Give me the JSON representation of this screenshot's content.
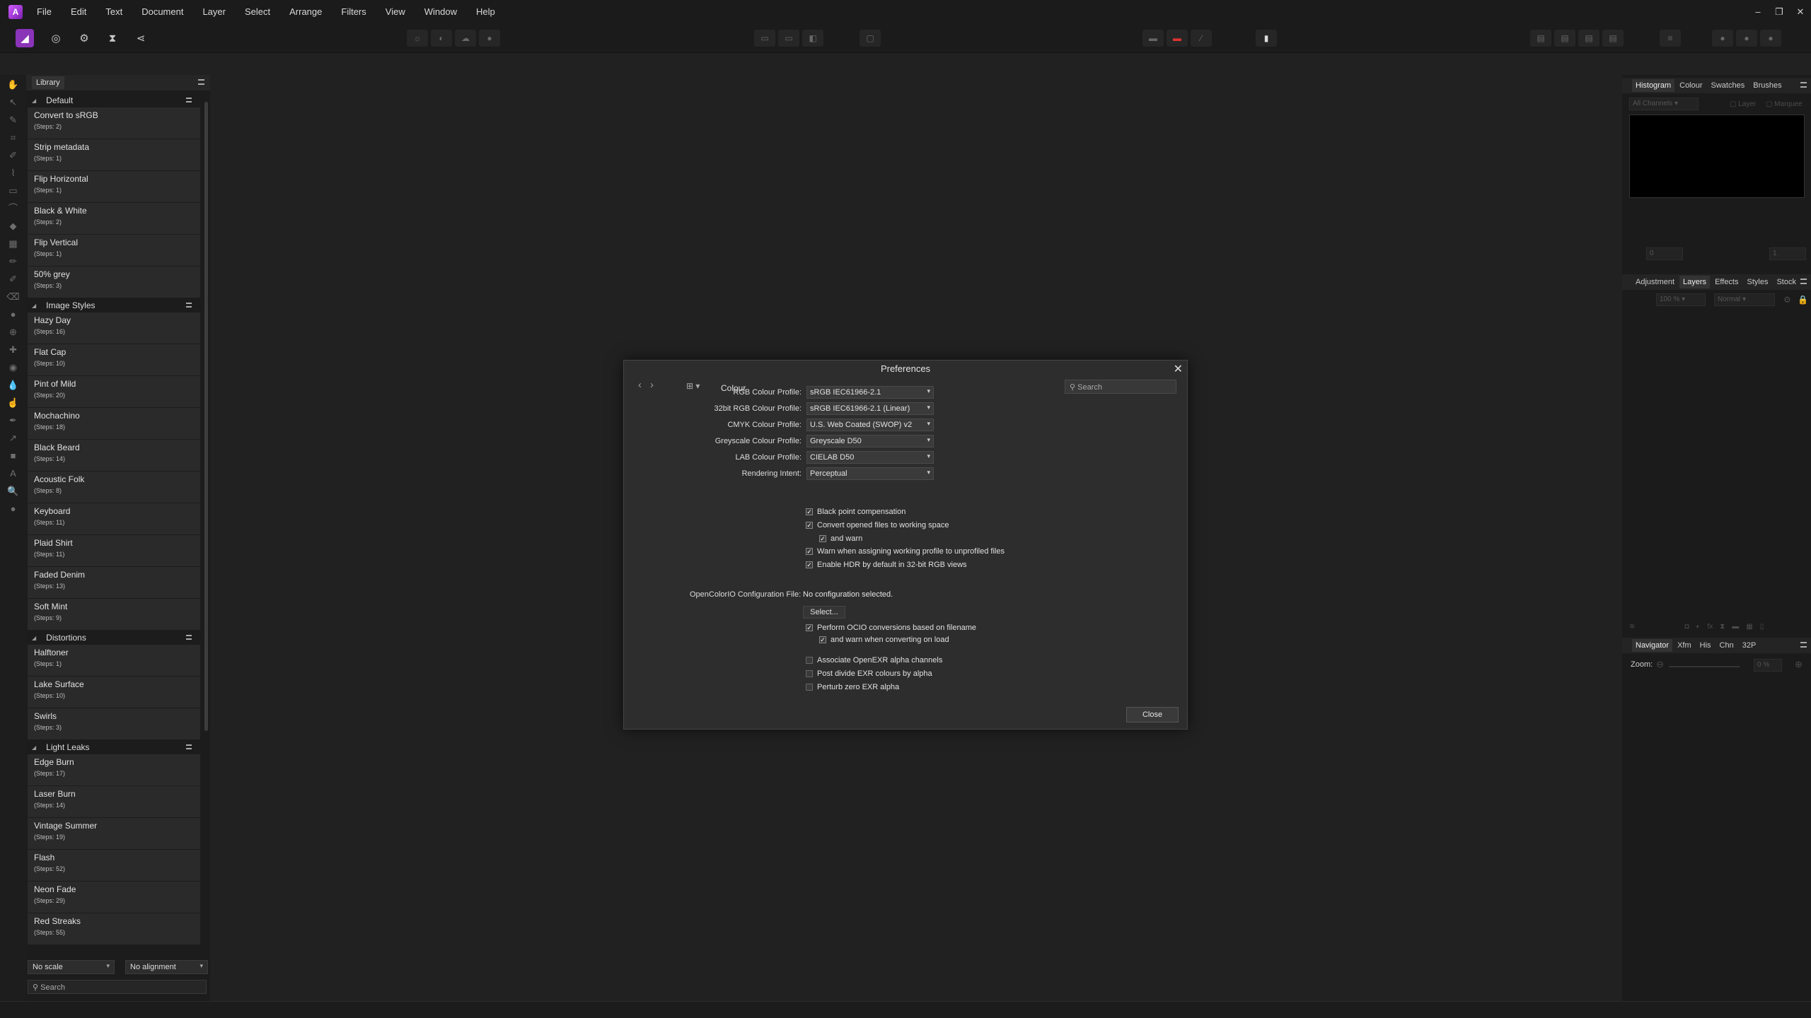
{
  "menu": [
    "File",
    "Edit",
    "Text",
    "Document",
    "Layer",
    "Select",
    "Arrange",
    "Filters",
    "View",
    "Window",
    "Help"
  ],
  "window_controls": [
    "–",
    "❐",
    "✕"
  ],
  "library": {
    "tab": "Library",
    "categories": [
      {
        "name": "Default",
        "macros": [
          {
            "name": "Convert to sRGB",
            "steps": "(Steps: 2)"
          },
          {
            "name": "Strip metadata",
            "steps": "(Steps: 1)"
          },
          {
            "name": "Flip Horizontal",
            "steps": "(Steps: 1)"
          },
          {
            "name": "Black & White",
            "steps": "(Steps: 2)"
          },
          {
            "name": "Flip Vertical",
            "steps": "(Steps: 1)"
          },
          {
            "name": "50% grey",
            "steps": "(Steps: 3)"
          }
        ]
      },
      {
        "name": "Image Styles",
        "macros": [
          {
            "name": "Hazy Day",
            "steps": "(Steps: 16)"
          },
          {
            "name": "Flat Cap",
            "steps": "(Steps: 10)"
          },
          {
            "name": "Pint of Mild",
            "steps": "(Steps: 20)"
          },
          {
            "name": "Mochachino",
            "steps": "(Steps: 18)"
          },
          {
            "name": "Black Beard",
            "steps": "(Steps: 14)"
          },
          {
            "name": "Acoustic Folk",
            "steps": "(Steps: 8)"
          },
          {
            "name": "Keyboard",
            "steps": "(Steps: 11)"
          },
          {
            "name": "Plaid Shirt",
            "steps": "(Steps: 11)"
          },
          {
            "name": "Faded Denim",
            "steps": "(Steps: 13)"
          },
          {
            "name": "Soft Mint",
            "steps": "(Steps: 9)"
          }
        ]
      },
      {
        "name": "Distortions",
        "macros": [
          {
            "name": "Halftoner",
            "steps": "(Steps: 1)"
          },
          {
            "name": "Lake Surface",
            "steps": "(Steps: 10)"
          },
          {
            "name": "Swirls",
            "steps": "(Steps: 3)"
          }
        ]
      },
      {
        "name": "Light Leaks",
        "macros": [
          {
            "name": "Edge Burn",
            "steps": "(Steps: 17)"
          },
          {
            "name": "Laser Burn",
            "steps": "(Steps: 14)"
          },
          {
            "name": "Vintage Summer",
            "steps": "(Steps: 19)"
          },
          {
            "name": "Flash",
            "steps": "(Steps: 52)"
          },
          {
            "name": "Neon Fade",
            "steps": "(Steps: 29)"
          },
          {
            "name": "Red Streaks",
            "steps": "(Steps: 55)"
          }
        ]
      }
    ],
    "scale_select": "No scale",
    "alignment_select": "No alignment",
    "search_placeholder": "Search"
  },
  "right_panel": {
    "top_tabs": [
      "Histogram",
      "Colour",
      "Swatches",
      "Brushes"
    ],
    "histogram": {
      "channels": "All Channels",
      "layer": "Layer",
      "marquee": "Marquee",
      "min": "0",
      "max": "1"
    },
    "mid_tabs": [
      "Adjustment",
      "Layers",
      "Effects",
      "Styles",
      "Stock"
    ],
    "layers": {
      "opacity": "100 %",
      "blend": "Normal"
    },
    "nav_tabs": [
      "Navigator",
      "Xfm",
      "His",
      "Chn",
      "32P"
    ],
    "zoom_label": "Zoom:",
    "zoom_value": "0 %"
  },
  "dialog": {
    "title": "Preferences",
    "section": "Colour",
    "search_placeholder": "Search",
    "fields": [
      {
        "label": "RGB Colour Profile:",
        "value": "sRGB IEC61966-2.1"
      },
      {
        "label": "32bit RGB Colour Profile:",
        "value": "sRGB IEC61966-2.1 (Linear)"
      },
      {
        "label": "CMYK Colour Profile:",
        "value": "U.S. Web Coated (SWOP) v2"
      },
      {
        "label": "Greyscale Colour Profile:",
        "value": "Greyscale D50"
      },
      {
        "label": "LAB Colour Profile:",
        "value": "CIELAB D50"
      },
      {
        "label": "Rendering Intent:",
        "value": "Perceptual"
      }
    ],
    "checks1": [
      {
        "label": "Black point compensation",
        "checked": true
      },
      {
        "label": "Convert opened files to working space",
        "checked": true
      },
      {
        "label": "and warn",
        "checked": true
      },
      {
        "label": "Warn when assigning working profile to unprofiled files",
        "checked": true
      },
      {
        "label": "Enable HDR by default in 32-bit RGB views",
        "checked": true
      }
    ],
    "ocio_label": "OpenColorIO Configuration File:",
    "ocio_value": "No configuration selected.",
    "select_label": "Select...",
    "checks2": [
      {
        "label": "Perform OCIO conversions based on filename",
        "checked": true
      },
      {
        "label": "and warn when converting on load",
        "checked": true
      },
      {
        "label": "Associate OpenEXR alpha channels",
        "checked": false
      },
      {
        "label": "Post divide EXR colours by alpha",
        "checked": false
      },
      {
        "label": "Perturb zero EXR alpha",
        "checked": false
      }
    ],
    "close_label": "Close"
  }
}
